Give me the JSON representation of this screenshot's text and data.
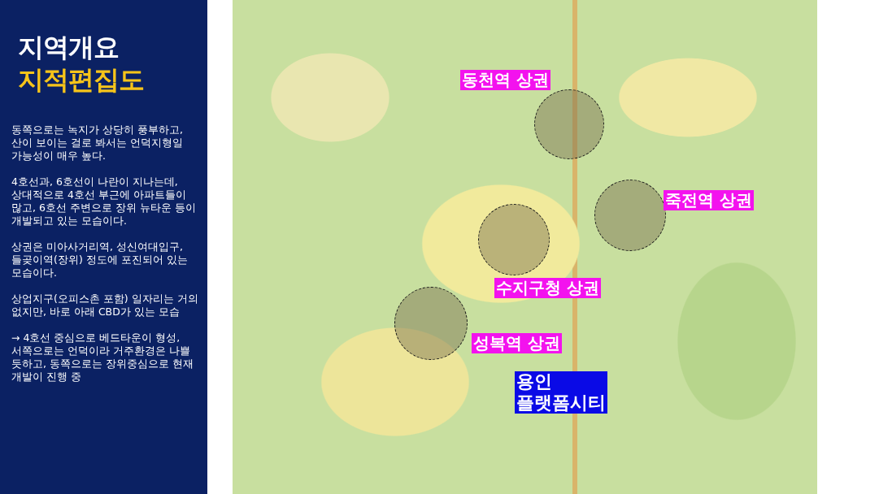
{
  "sidebar": {
    "title": "지역개요",
    "subtitle": "지적편집도",
    "paragraphs": [
      "동쪽으로는 녹지가 상당히 풍부하고, 산이 보이는 걸로 봐서는 언덕지형일 가능성이 매우 높다.",
      "4호선과, 6호선이 나란이 지나는데, 상대적으로 4호선 부근에 아파트들이 많고, 6호선 주변으로 장위 뉴타운 등이 개발되고 있는 모습이다.",
      "상권은 미아사거리역, 성신여대입구, 들곶이역(장위) 정도에 포진되어 있는 모습이다.",
      "상업지구(오피스촌 포함) 일자리는 거의 없지만, 바로 아래 CBD가 있는 모습",
      "→ 4호선 중심으로 베드타운이 형성, 서쪽으로는 언덕이라 거주환경은 나쁠 듯하고, 동쪽으로는 장위중심으로 현재 개발이 진행 중"
    ]
  },
  "map": {
    "areas": [
      {
        "label": "동천역 상권",
        "kind": "commercial"
      },
      {
        "label": "죽전역 상권",
        "kind": "commercial"
      },
      {
        "label": "수지구청 상권",
        "kind": "commercial"
      },
      {
        "label": "성복역 상권",
        "kind": "commercial"
      },
      {
        "label": "용인 플랫폼시티",
        "kind": "development"
      }
    ]
  }
}
